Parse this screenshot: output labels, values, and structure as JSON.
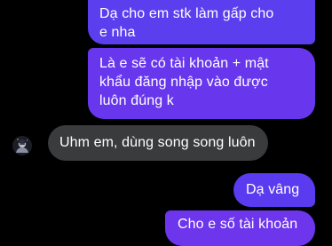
{
  "conversation": {
    "messages": [
      {
        "sender": "me",
        "lines": [
          "Dạ cho em stk làm gấp cho",
          "e nha"
        ]
      },
      {
        "sender": "me",
        "lines": [
          "Là e sẽ có tài khoản + mật",
          "khẩu đăng nhập vào được",
          "luôn đúng k"
        ]
      },
      {
        "sender": "other",
        "lines": [
          "Uhm em, dùng song song luôn"
        ]
      },
      {
        "sender": "me",
        "lines": [
          "Dạ vâng"
        ]
      },
      {
        "sender": "me",
        "lines": [
          "Cho e số tài khoản"
        ]
      }
    ]
  },
  "colors": {
    "background": "#000000",
    "outgoing_bubble": "#5b3fee",
    "incoming_bubble": "#3a3b3c",
    "text": "#ffffff"
  },
  "icons": {
    "avatar": "user-avatar-icon"
  }
}
